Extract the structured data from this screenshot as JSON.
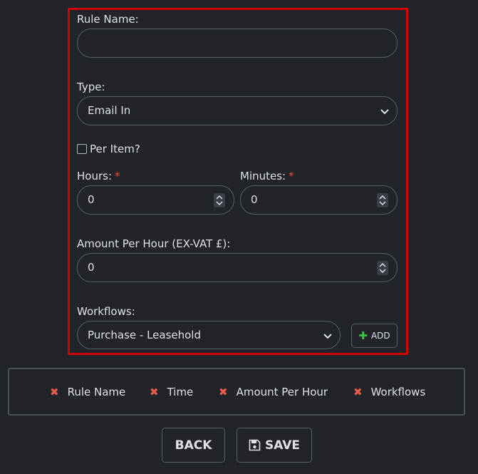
{
  "form": {
    "rule_name_label": "Rule Name:",
    "rule_name_value": "",
    "type_label": "Type:",
    "type_value": "Email In",
    "per_item_label": "Per Item?",
    "per_item_checked": false,
    "hours_label": "Hours:",
    "hours_value": "0",
    "minutes_label": "Minutes:",
    "minutes_value": "0",
    "required_marker": "*",
    "amount_label": "Amount Per Hour (EX-VAT £):",
    "amount_value": "0",
    "workflows_label": "Workflows:",
    "workflows_value": "Purchase - Leasehold",
    "add_label": "ADD"
  },
  "validation": {
    "items": [
      "Rule Name",
      "Time",
      "Amount Per Hour",
      "Workflows"
    ]
  },
  "actions": {
    "back_label": "BACK",
    "save_label": "SAVE"
  },
  "colors": {
    "highlight_border": "#d00000",
    "error_x": "#ec5c4a",
    "add_plus": "#3fbf4a"
  }
}
